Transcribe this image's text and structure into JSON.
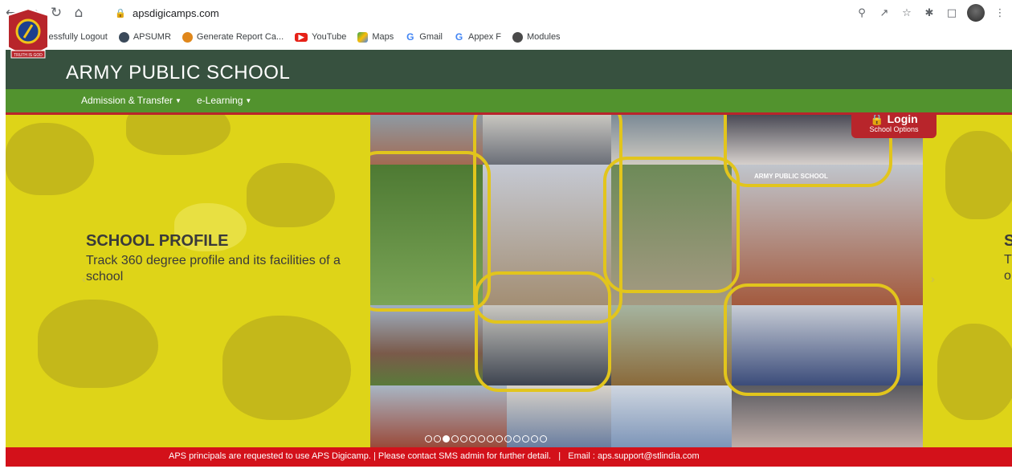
{
  "browser": {
    "url": "apsdigicamps.com",
    "nav_icons": [
      "back-icon",
      "forward-icon",
      "reload-icon",
      "home-icon"
    ],
    "right_icons": [
      "zoom-icon",
      "share-icon",
      "star-icon",
      "extensions-icon",
      "sidebar-icon"
    ],
    "bookmarks": [
      {
        "label": "Successfully Logout",
        "color": "#f2b233"
      },
      {
        "label": "APSUMR",
        "color": "#3b4a5a"
      },
      {
        "label": "Generate Report Ca...",
        "color": "#e0871b"
      },
      {
        "label": "YouTube",
        "color": "#e62117"
      },
      {
        "label": "Maps",
        "color": "#34a853"
      },
      {
        "label": "Gmail",
        "color": "#4285f4"
      },
      {
        "label": "Appex F",
        "color": "#4285f4"
      },
      {
        "label": "Modules",
        "color": "#4a4a4a"
      }
    ]
  },
  "site": {
    "title": "ARMY PUBLIC SCHOOL",
    "crest_motto": "TRUTH IS GOD",
    "menu": [
      {
        "label": "Admission & Transfer"
      },
      {
        "label": "e-Learning"
      }
    ],
    "login": {
      "title": "Login",
      "subtitle": "School Options"
    }
  },
  "hero": {
    "heading": "SCHOOL PROFILE",
    "subtext": "Track 360 degree profile and its facilities of a school",
    "peek_heading": "S",
    "peek_line1": "T",
    "peek_line2": "o",
    "school_sign": "ARMY PUBLIC SCHOOL",
    "slide_count": 14,
    "active_slide": 2
  },
  "footer": {
    "text": "APS principals are requested to use APS Digicamp. | Please contact SMS admin for further detail.   |   Email : aps.support@stlindia.com"
  },
  "colors": {
    "header": "#37513f",
    "menu": "#52932e",
    "hero": "#ded418",
    "accent_red": "#d3111a"
  }
}
